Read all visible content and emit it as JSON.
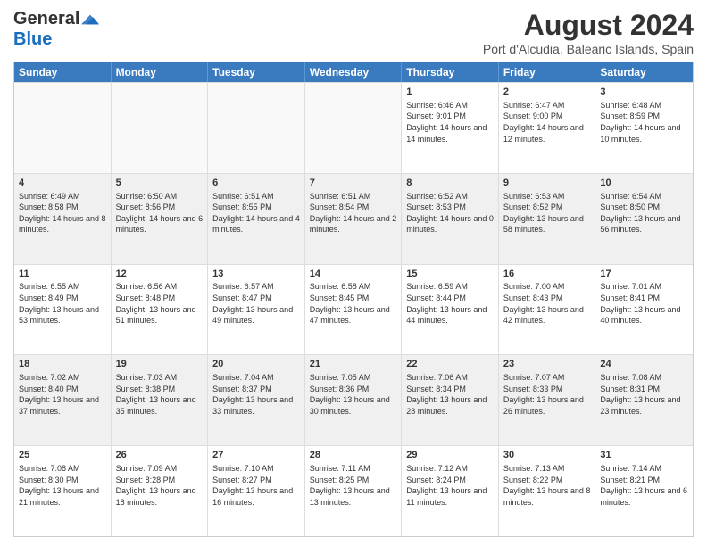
{
  "header": {
    "logo_general": "General",
    "logo_blue": "Blue",
    "main_title": "August 2024",
    "subtitle": "Port d'Alcudia, Balearic Islands, Spain"
  },
  "calendar": {
    "days": [
      "Sunday",
      "Monday",
      "Tuesday",
      "Wednesday",
      "Thursday",
      "Friday",
      "Saturday"
    ],
    "rows": [
      [
        {
          "day": "",
          "empty": true
        },
        {
          "day": "",
          "empty": true
        },
        {
          "day": "",
          "empty": true
        },
        {
          "day": "",
          "empty": true
        },
        {
          "day": "1",
          "sunrise": "6:46 AM",
          "sunset": "9:01 PM",
          "daylight": "14 hours and 14 minutes."
        },
        {
          "day": "2",
          "sunrise": "6:47 AM",
          "sunset": "9:00 PM",
          "daylight": "14 hours and 12 minutes."
        },
        {
          "day": "3",
          "sunrise": "6:48 AM",
          "sunset": "8:59 PM",
          "daylight": "14 hours and 10 minutes."
        }
      ],
      [
        {
          "day": "4",
          "sunrise": "6:49 AM",
          "sunset": "8:58 PM",
          "daylight": "14 hours and 8 minutes."
        },
        {
          "day": "5",
          "sunrise": "6:50 AM",
          "sunset": "8:56 PM",
          "daylight": "14 hours and 6 minutes."
        },
        {
          "day": "6",
          "sunrise": "6:51 AM",
          "sunset": "8:55 PM",
          "daylight": "14 hours and 4 minutes."
        },
        {
          "day": "7",
          "sunrise": "6:51 AM",
          "sunset": "8:54 PM",
          "daylight": "14 hours and 2 minutes."
        },
        {
          "day": "8",
          "sunrise": "6:52 AM",
          "sunset": "8:53 PM",
          "daylight": "14 hours and 0 minutes."
        },
        {
          "day": "9",
          "sunrise": "6:53 AM",
          "sunset": "8:52 PM",
          "daylight": "13 hours and 58 minutes."
        },
        {
          "day": "10",
          "sunrise": "6:54 AM",
          "sunset": "8:50 PM",
          "daylight": "13 hours and 56 minutes."
        }
      ],
      [
        {
          "day": "11",
          "sunrise": "6:55 AM",
          "sunset": "8:49 PM",
          "daylight": "13 hours and 53 minutes."
        },
        {
          "day": "12",
          "sunrise": "6:56 AM",
          "sunset": "8:48 PM",
          "daylight": "13 hours and 51 minutes."
        },
        {
          "day": "13",
          "sunrise": "6:57 AM",
          "sunset": "8:47 PM",
          "daylight": "13 hours and 49 minutes."
        },
        {
          "day": "14",
          "sunrise": "6:58 AM",
          "sunset": "8:45 PM",
          "daylight": "13 hours and 47 minutes."
        },
        {
          "day": "15",
          "sunrise": "6:59 AM",
          "sunset": "8:44 PM",
          "daylight": "13 hours and 44 minutes."
        },
        {
          "day": "16",
          "sunrise": "7:00 AM",
          "sunset": "8:43 PM",
          "daylight": "13 hours and 42 minutes."
        },
        {
          "day": "17",
          "sunrise": "7:01 AM",
          "sunset": "8:41 PM",
          "daylight": "13 hours and 40 minutes."
        }
      ],
      [
        {
          "day": "18",
          "sunrise": "7:02 AM",
          "sunset": "8:40 PM",
          "daylight": "13 hours and 37 minutes."
        },
        {
          "day": "19",
          "sunrise": "7:03 AM",
          "sunset": "8:38 PM",
          "daylight": "13 hours and 35 minutes."
        },
        {
          "day": "20",
          "sunrise": "7:04 AM",
          "sunset": "8:37 PM",
          "daylight": "13 hours and 33 minutes."
        },
        {
          "day": "21",
          "sunrise": "7:05 AM",
          "sunset": "8:36 PM",
          "daylight": "13 hours and 30 minutes."
        },
        {
          "day": "22",
          "sunrise": "7:06 AM",
          "sunset": "8:34 PM",
          "daylight": "13 hours and 28 minutes."
        },
        {
          "day": "23",
          "sunrise": "7:07 AM",
          "sunset": "8:33 PM",
          "daylight": "13 hours and 26 minutes."
        },
        {
          "day": "24",
          "sunrise": "7:08 AM",
          "sunset": "8:31 PM",
          "daylight": "13 hours and 23 minutes."
        }
      ],
      [
        {
          "day": "25",
          "sunrise": "7:08 AM",
          "sunset": "8:30 PM",
          "daylight": "13 hours and 21 minutes."
        },
        {
          "day": "26",
          "sunrise": "7:09 AM",
          "sunset": "8:28 PM",
          "daylight": "13 hours and 18 minutes."
        },
        {
          "day": "27",
          "sunrise": "7:10 AM",
          "sunset": "8:27 PM",
          "daylight": "13 hours and 16 minutes."
        },
        {
          "day": "28",
          "sunrise": "7:11 AM",
          "sunset": "8:25 PM",
          "daylight": "13 hours and 13 minutes."
        },
        {
          "day": "29",
          "sunrise": "7:12 AM",
          "sunset": "8:24 PM",
          "daylight": "13 hours and 11 minutes."
        },
        {
          "day": "30",
          "sunrise": "7:13 AM",
          "sunset": "8:22 PM",
          "daylight": "13 hours and 8 minutes."
        },
        {
          "day": "31",
          "sunrise": "7:14 AM",
          "sunset": "8:21 PM",
          "daylight": "13 hours and 6 minutes."
        }
      ]
    ]
  }
}
